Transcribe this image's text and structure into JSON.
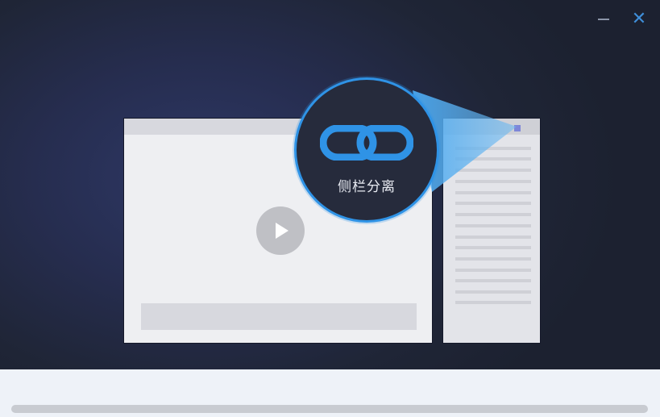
{
  "window": {
    "minimize_icon": "minimize-icon",
    "close_icon": "close-icon",
    "close_glyph": "✕"
  },
  "feature": {
    "label": "侧栏分离",
    "icon": "link-icon"
  },
  "illustration": {
    "player_icon": "play-icon",
    "sidebar_handle_icon": "detach-handle-icon"
  },
  "colors": {
    "accent": "#2f93e6",
    "handle": "#7e86d8",
    "background_dark": "#1f2536"
  }
}
